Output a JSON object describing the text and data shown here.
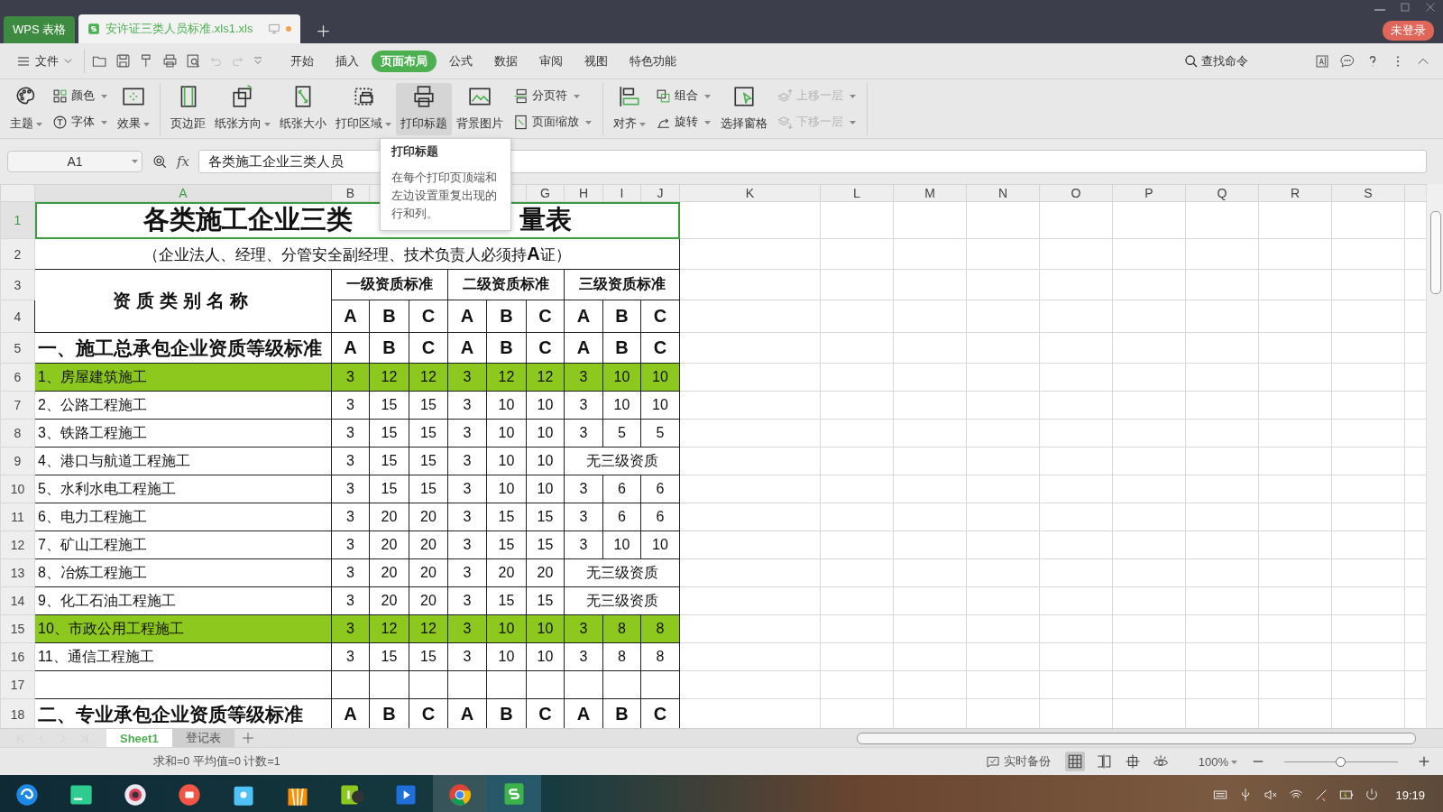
{
  "title_bar": {
    "app_tab": "WPS 表格",
    "doc_tab": {
      "title": "安许证三类人员标准.xls1.xls",
      "unsaved": true
    },
    "login_badge": "未登录"
  },
  "menu_bar": {
    "file_menu": "文件",
    "tabs": [
      {
        "label": "开始",
        "selected": false
      },
      {
        "label": "插入",
        "selected": false
      },
      {
        "label": "页面布局",
        "selected": true
      },
      {
        "label": "公式",
        "selected": false
      },
      {
        "label": "数据",
        "selected": false
      },
      {
        "label": "审阅",
        "selected": false
      },
      {
        "label": "视图",
        "selected": false
      },
      {
        "label": "特色功能",
        "selected": false
      }
    ],
    "search": "查找命令"
  },
  "ribbon": {
    "groups": [
      [
        {
          "kind": "large",
          "label": "主题",
          "caret": true,
          "selected": false,
          "disabled": false
        },
        {
          "kind": "stack",
          "items": [
            {
              "label": "颜色",
              "caret": true,
              "disabled": false
            },
            {
              "label": "字体",
              "caret": true,
              "disabled": false
            }
          ]
        },
        {
          "kind": "large",
          "label": "效果",
          "caret": true,
          "selected": false,
          "disabled": false
        }
      ],
      [
        {
          "kind": "large",
          "label": "页边距",
          "caret": false,
          "selected": false,
          "disabled": false
        },
        {
          "kind": "large",
          "label": "纸张方向",
          "caret": true,
          "selected": false,
          "disabled": false
        },
        {
          "kind": "large",
          "label": "纸张大小",
          "caret": false,
          "selected": false,
          "disabled": false
        },
        {
          "kind": "large",
          "label": "打印区域",
          "caret": true,
          "selected": false,
          "disabled": false
        },
        {
          "kind": "large",
          "label": "打印标题",
          "caret": false,
          "selected": true,
          "disabled": false
        },
        {
          "kind": "large",
          "label": "背景图片",
          "caret": false,
          "selected": false,
          "disabled": false
        },
        {
          "kind": "stack",
          "items": [
            {
              "label": "分页符",
              "caret": true,
              "disabled": false
            },
            {
              "label": "页面缩放",
              "caret": true,
              "disabled": false
            }
          ]
        }
      ],
      [
        {
          "kind": "large",
          "label": "对齐",
          "caret": true,
          "selected": false,
          "disabled": false
        },
        {
          "kind": "stack",
          "items": [
            {
              "label": "组合",
              "caret": true,
              "disabled": false
            },
            {
              "label": "旋转",
              "caret": true,
              "disabled": false
            }
          ]
        },
        {
          "kind": "large",
          "label": "选择窗格",
          "caret": false,
          "selected": false,
          "disabled": false
        },
        {
          "kind": "stack",
          "items": [
            {
              "label": "上移一层",
              "caret": true,
              "disabled": true
            },
            {
              "label": "下移一层",
              "caret": true,
              "disabled": true
            }
          ]
        }
      ]
    ]
  },
  "tooltip": {
    "title": "打印标题",
    "text": "在每个打印页顶端和左边设置重复出现的行和列。"
  },
  "formula_bar": {
    "name_box": "A1",
    "fx_label": "fx",
    "formula": "各类施工企业三类人员"
  },
  "sheet": {
    "columns": [
      {
        "label": "A",
        "selected": true
      },
      {
        "label": "B",
        "selected": false
      },
      {},
      {},
      {},
      {},
      {
        "label": "G",
        "selected": false
      },
      {
        "label": "H",
        "selected": false
      },
      {
        "label": "I",
        "selected": false
      },
      {
        "label": "J",
        "selected": false
      },
      {
        "label": "K",
        "selected": false
      },
      {
        "label": "L",
        "selected": false
      },
      {
        "label": "M",
        "selected": false
      },
      {
        "label": "N",
        "selected": false
      },
      {
        "label": "O",
        "selected": false
      },
      {
        "label": "P",
        "selected": false
      },
      {
        "label": "Q",
        "selected": false
      },
      {
        "label": "R",
        "selected": false
      },
      {
        "label": "S",
        "selected": false
      }
    ],
    "rows": [
      {
        "number": "1",
        "kind": "title",
        "parts": [
          "各类施工企业三类",
          "量表"
        ],
        "selected": true
      },
      {
        "number": "2",
        "kind": "subtitle",
        "text": "（企业法人、经理、分管安全副经理、技术负责人必须持**A**证）",
        "selected": false
      },
      {
        "number": "3",
        "kind": "group_header",
        "label": "资质类别名称",
        "groups": [
          "一级资质标准",
          "二级资质标准",
          "三级资质标准"
        ],
        "selected": false
      },
      {
        "number": "4",
        "kind": "grades",
        "values": [
          "A",
          "B",
          "C",
          "A",
          "B",
          "C",
          "A",
          "B",
          "C"
        ],
        "selected": false
      },
      {
        "number": "5",
        "kind": "section",
        "label": "一、施工总承包企业资质等级标准",
        "values": [
          "A",
          "B",
          "C",
          "A",
          "B",
          "C",
          "A",
          "B",
          "C"
        ],
        "highlighted": false,
        "selected": false
      },
      {
        "number": "6",
        "kind": "item",
        "label": "1、房屋建筑施工",
        "values": [
          "3",
          "12",
          "12",
          "3",
          "12",
          "12",
          "3",
          "10",
          "10"
        ],
        "highlighted": true,
        "selected": false
      },
      {
        "number": "7",
        "kind": "item",
        "label": "2、公路工程施工",
        "values": [
          "3",
          "15",
          "15",
          "3",
          "10",
          "10",
          "3",
          "10",
          "10"
        ],
        "highlighted": false,
        "selected": false
      },
      {
        "number": "8",
        "kind": "item",
        "label": "3、铁路工程施工",
        "values": [
          "3",
          "15",
          "15",
          "3",
          "10",
          "10",
          "3",
          "5",
          "5"
        ],
        "highlighted": false,
        "selected": false
      },
      {
        "number": "9",
        "kind": "item",
        "label": "4、港口与航道工程施工",
        "values": [
          "3",
          "15",
          "15",
          "3",
          "10",
          "10"
        ],
        "note": "无三级资质",
        "highlighted": false,
        "selected": false
      },
      {
        "number": "10",
        "kind": "item",
        "label": "5、水利水电工程施工",
        "values": [
          "3",
          "15",
          "15",
          "3",
          "10",
          "10",
          "3",
          "6",
          "6"
        ],
        "highlighted": false,
        "selected": false
      },
      {
        "number": "11",
        "kind": "item",
        "label": "6、电力工程施工",
        "values": [
          "3",
          "20",
          "20",
          "3",
          "15",
          "15",
          "3",
          "6",
          "6"
        ],
        "highlighted": false,
        "selected": false
      },
      {
        "number": "12",
        "kind": "item",
        "label": "7、矿山工程施工",
        "values": [
          "3",
          "20",
          "20",
          "3",
          "15",
          "15",
          "3",
          "10",
          "10"
        ],
        "highlighted": false,
        "selected": false
      },
      {
        "number": "13",
        "kind": "item",
        "label": "8、冶炼工程施工",
        "values": [
          "3",
          "20",
          "20",
          "3",
          "20",
          "20"
        ],
        "note": "无三级资质",
        "highlighted": false,
        "selected": false
      },
      {
        "number": "14",
        "kind": "item",
        "label": "9、化工石油工程施工",
        "values": [
          "3",
          "20",
          "20",
          "3",
          "15",
          "15"
        ],
        "note": "无三级资质",
        "highlighted": false,
        "selected": false
      },
      {
        "number": "15",
        "kind": "item",
        "label": "10、市政公用工程施工",
        "values": [
          "3",
          "12",
          "12",
          "3",
          "10",
          "10",
          "3",
          "8",
          "8"
        ],
        "highlighted": true,
        "selected": false
      },
      {
        "number": "16",
        "kind": "item",
        "label": "11、通信工程施工",
        "values": [
          "3",
          "15",
          "15",
          "3",
          "10",
          "10",
          "3",
          "8",
          "8"
        ],
        "highlighted": false,
        "selected": false
      },
      {
        "number": "17",
        "kind": "blank",
        "selected": false
      },
      {
        "number": "18",
        "kind": "section",
        "label": "二、专业承包企业资质等级标准",
        "values": [
          "A",
          "B",
          "C",
          "A",
          "B",
          "C",
          "A",
          "B",
          "C"
        ],
        "highlighted": false,
        "selected": false
      }
    ]
  },
  "sheet_tabs": [
    {
      "label": "Sheet1",
      "selected": true
    },
    {
      "label": "登记表",
      "selected": false
    }
  ],
  "status_bar": {
    "stats": "求和=0 平均值=0 计数=1",
    "backup": "实时备份",
    "view_buttons": [
      {
        "selected": true
      },
      {
        "selected": false
      },
      {
        "selected": false
      }
    ],
    "zoom": "100%",
    "zoom_slider": {
      "level": 0.5
    }
  },
  "taskbar": {
    "apps": [
      {
        "selected": false,
        "hovered": false
      },
      {
        "selected": false,
        "hovered": false
      },
      {
        "selected": false,
        "hovered": false
      },
      {
        "selected": false,
        "hovered": false
      },
      {
        "selected": false,
        "hovered": false
      },
      {
        "selected": false,
        "hovered": false
      },
      {
        "selected": false,
        "hovered": false
      },
      {
        "selected": false,
        "hovered": false
      },
      {
        "selected": false,
        "hovered": true
      },
      {
        "selected": true,
        "hovered": false
      }
    ],
    "clock": "19:19"
  }
}
